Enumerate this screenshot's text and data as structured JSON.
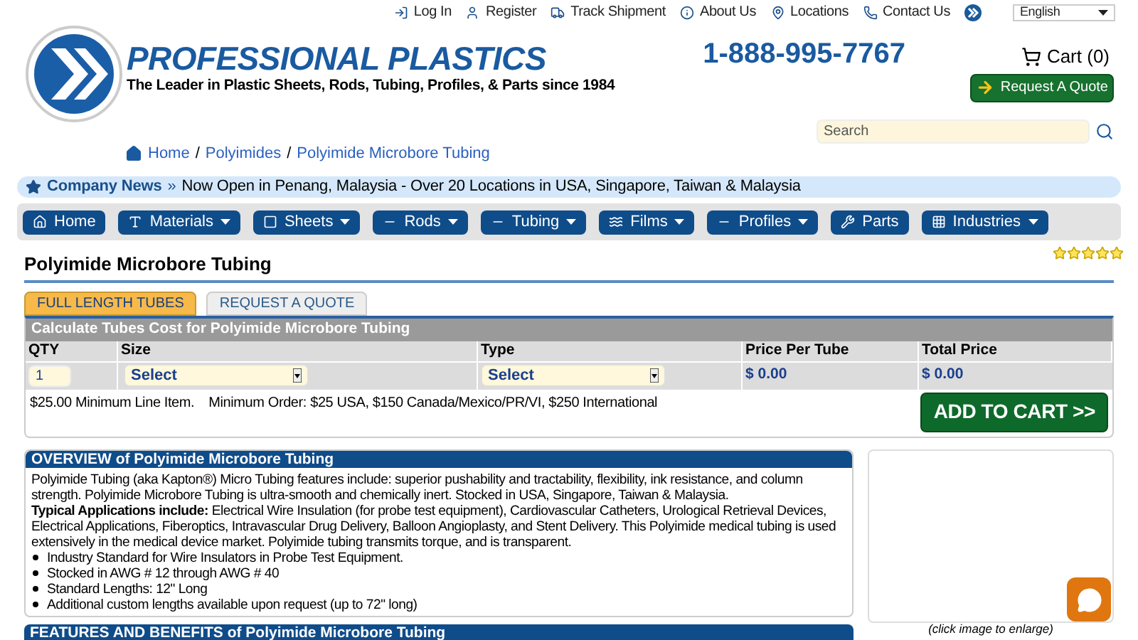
{
  "top_links": [
    {
      "label": "Log In"
    },
    {
      "label": "Register"
    },
    {
      "label": "Track Shipment"
    },
    {
      "label": "About Us"
    },
    {
      "label": "Locations"
    },
    {
      "label": "Contact Us"
    }
  ],
  "language": "English",
  "brand": {
    "name": "PROFESSIONAL PLASTICS",
    "tagline": "The Leader in Plastic Sheets, Rods, Tubing, Profiles, & Parts since 1984"
  },
  "phone": "1-888-995-7767",
  "cart": "Cart (0)",
  "quote_button": "Request A Quote",
  "search": {
    "placeholder": "Search"
  },
  "breadcrumb": [
    "Home",
    "Polyimides",
    "Polyimide Microbore Tubing"
  ],
  "breadcrumb_separators": [
    "/",
    "/"
  ],
  "news": {
    "label": "Company News",
    "chevron": "»",
    "text": "Now Open in Penang, Malaysia - Over 20 Locations in USA, Singapore, Taiwan & Malaysia"
  },
  "nav": [
    {
      "label": "Home",
      "dropdown": false
    },
    {
      "label": "Materials",
      "dropdown": true
    },
    {
      "label": "Sheets",
      "dropdown": true
    },
    {
      "label": "Rods",
      "dropdown": true
    },
    {
      "label": "Tubing",
      "dropdown": true
    },
    {
      "label": "Films",
      "dropdown": true
    },
    {
      "label": "Profiles",
      "dropdown": true
    },
    {
      "label": "Parts",
      "dropdown": false
    },
    {
      "label": "Industries",
      "dropdown": true
    }
  ],
  "page_title": "Polyimide Microbore Tubing",
  "rating": {
    "stars": 5
  },
  "tabs": [
    {
      "label": "FULL LENGTH TUBES",
      "selected": true
    },
    {
      "label": "REQUEST A QUOTE",
      "selected": false
    }
  ],
  "calculator": {
    "title": "Calculate Tubes Cost for Polyimide Microbore Tubing",
    "columns": [
      "QTY",
      "Size",
      "Type",
      "Price Per Tube",
      "Total Price"
    ],
    "qty": "1",
    "size": "Select",
    "type": "Select",
    "price_per_tube": "$ 0.00",
    "total_price": "$ 0.00",
    "min_line": "$25.00 Minimum Line Item.",
    "min_order": "Minimum Order: $25 USA, $150 Canada/Mexico/PR/VI, $250 International",
    "add_button": "ADD TO CART >>"
  },
  "overview": {
    "title": "OVERVIEW of Polyimide Microbore Tubing",
    "intro": "Polyimide Tubing (aka Kapton®) Micro Tubing features include: superior pushability and tractability, flexibility, ink resistance, and column strength. Polyimide Microbore Tubing is ultra-smooth and chemically inert. Stocked in USA, Singapore, Taiwan & Malaysia.",
    "applications": "**Typical Applications include:** Electrical Wire Insulation (for probe test equipment), Cardiovascular Catheters, Urological Retrieval Devices, Electrical Applications, Fiberoptics, Intravascular Drug Delivery, Balloon Angioplasty, and Stent Delivery. This Polyimide medical tubing is used extensively in the medical device market. Polyimide tubing transmits torque, and is transparent.",
    "bullets": [
      "Industry Standard for Wire Insulators in Probe Test Equipment.",
      "Stocked in AWG # 12 through AWG # 40",
      "Standard Lengths: 12\" Long",
      "Additional custom lengths available upon request (up to 72\" long)"
    ]
  },
  "features_title": "FEATURES AND BENEFITS of Polyimide Microbore Tubing",
  "image_caption": "(click image to enlarge)"
}
